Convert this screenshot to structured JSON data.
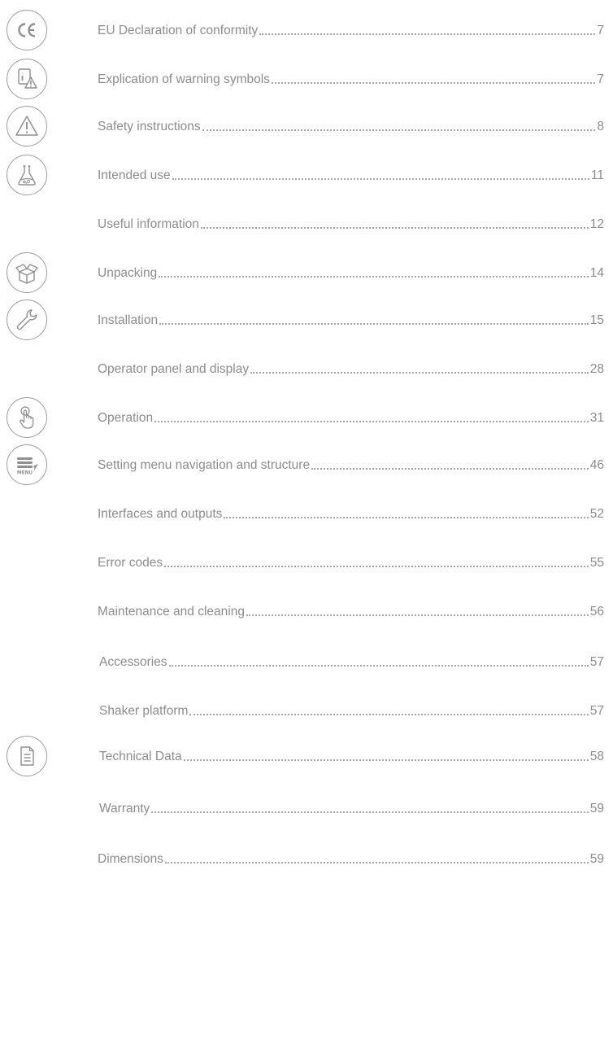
{
  "colors": {
    "text": "#8c8c8c",
    "icon_stroke": "#9b9b9b",
    "leader": "#a6a6a6",
    "background": "#ffffff"
  },
  "toc": [
    {
      "title": "EU Declaration of conformity",
      "page": "7",
      "icon": "ce-mark-icon"
    },
    {
      "title": "Explication of warning symbols",
      "page": "7",
      "icon": "info-warning-icon"
    },
    {
      "title": "Safety instructions",
      "page": "8",
      "icon": "warning-triangle-icon"
    },
    {
      "title": "Intended use",
      "page": "11",
      "icon": "lab-flask-icon"
    },
    {
      "title": "Useful information",
      "page": "12",
      "icon": ""
    },
    {
      "title": "Unpacking",
      "page": "14",
      "icon": "open-box-icon"
    },
    {
      "title": "Installation",
      "page": "15",
      "icon": "wrench-icon"
    },
    {
      "title": "Operator panel and display",
      "page": "28",
      "icon": ""
    },
    {
      "title": "Operation",
      "page": "31",
      "icon": "touch-hand-icon"
    },
    {
      "title": "Setting menu navigation and structure",
      "page": "46",
      "icon": "menu-icon",
      "icon_label": "MENU"
    },
    {
      "title": "Interfaces and outputs",
      "page": "52",
      "icon": ""
    },
    {
      "title": "Error codes",
      "page": "55",
      "icon": ""
    },
    {
      "title": "Maintenance and cleaning",
      "page": "56",
      "icon": ""
    },
    {
      "title": "Accessories",
      "page": "57",
      "icon": ""
    },
    {
      "title": "Shaker platform",
      "page": "57",
      "icon": ""
    },
    {
      "title": "Technical Data",
      "page": "58",
      "icon": "document-icon"
    },
    {
      "title": "Warranty",
      "page": "59",
      "icon": ""
    },
    {
      "title": "Dimensions",
      "page": "59",
      "icon": ""
    }
  ]
}
